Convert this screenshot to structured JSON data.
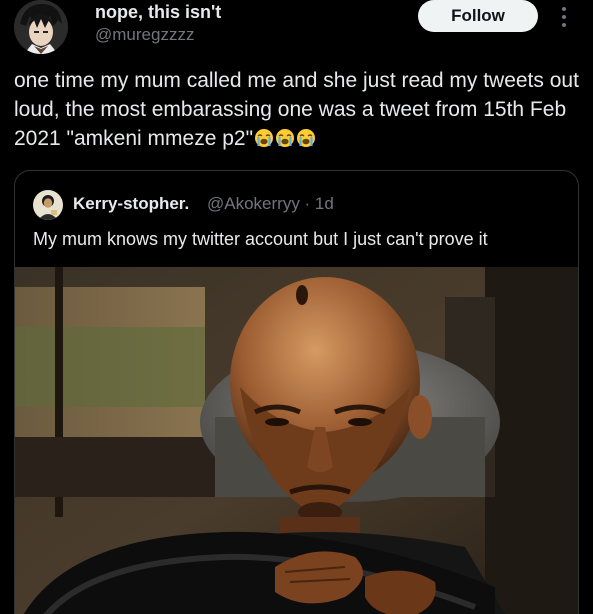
{
  "author": {
    "display_name": "nope, this isn't",
    "handle": "@muregzzzz"
  },
  "actions": {
    "follow_label": "Follow",
    "more_icon": "more-vertical-icon"
  },
  "tweet": {
    "text": "one time my mum called me and she just read my tweets out loud, the most embarassing one was a tweet from 15th Feb 2021 \"amkeni mmeze p2\"",
    "emojis": [
      "loudly-crying-face-icon",
      "loudly-crying-face-icon",
      "loudly-crying-face-icon"
    ]
  },
  "quoted_tweet": {
    "display_name": "Kerry-stopher.",
    "handle_and_time": "@Akokerryy · 1d",
    "text": "My mum knows my twitter account but I just can't prove it",
    "media": "photo-man-driving-car"
  },
  "colors": {
    "background": "#000000",
    "text_primary": "#e7e9ea",
    "text_secondary": "#71767b",
    "follow_button_bg": "#eff3f4",
    "border": "#2f3336"
  }
}
